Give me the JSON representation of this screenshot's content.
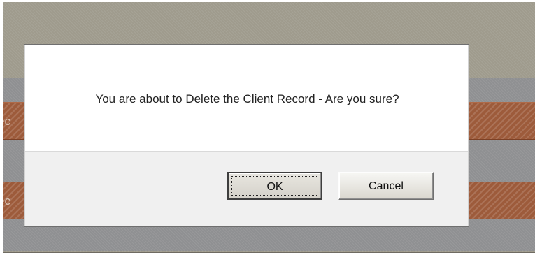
{
  "background": {
    "records": [
      {
        "text_fragment": "ec"
      },
      {
        "text_fragment": "ec"
      }
    ]
  },
  "dialog": {
    "message": "You are about to Delete the Client Record - Are you sure?",
    "buttons": {
      "ok_label": "OK",
      "cancel_label": "Cancel"
    }
  },
  "colors": {
    "frame": "#9f9b8d",
    "band": "#8f9092",
    "record_row": "#9d5b3b",
    "dialog_background": "#ffffff",
    "dialog_footer": "#f0f0f0"
  }
}
